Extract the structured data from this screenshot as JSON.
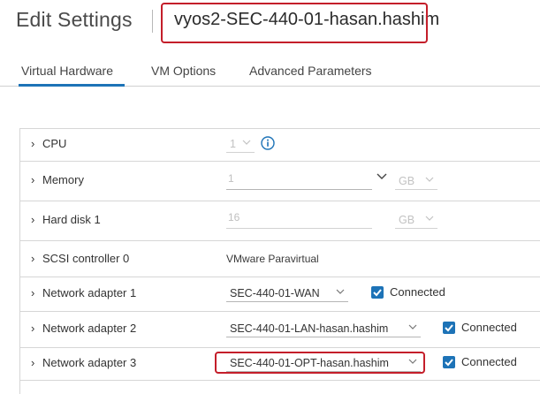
{
  "header": {
    "title": "Edit Settings",
    "vm_name": "vyos2-SEC-440-01-hasan.hashim"
  },
  "tabs": [
    {
      "label": "Virtual Hardware",
      "active": true
    },
    {
      "label": "VM Options",
      "active": false
    },
    {
      "label": "Advanced Parameters",
      "active": false
    }
  ],
  "colors": {
    "accent": "#1d73b7",
    "highlight": "#c41e2a"
  },
  "hardware": {
    "cpu": {
      "label": "CPU",
      "value": "1"
    },
    "memory": {
      "label": "Memory",
      "value": "1",
      "unit": "GB"
    },
    "hard_disk": {
      "label": "Hard disk 1",
      "value": "16",
      "unit": "GB"
    },
    "scsi": {
      "label": "SCSI controller 0",
      "value": "VMware Paravirtual"
    },
    "network_adapters": [
      {
        "label": "Network adapter 1",
        "network": "SEC-440-01-WAN",
        "connected_label": "Connected",
        "connected": true
      },
      {
        "label": "Network adapter 2",
        "network": "SEC-440-01-LAN-hasan.hashim",
        "connected_label": "Connected",
        "connected": true
      },
      {
        "label": "Network adapter 3",
        "network": "SEC-440-01-OPT-hasan.hashim",
        "connected_label": "Connected",
        "connected": true
      }
    ]
  }
}
